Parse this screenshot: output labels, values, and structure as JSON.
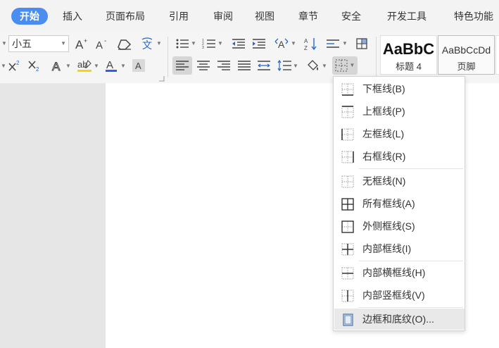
{
  "menubar": {
    "tabs": [
      {
        "label": "开始",
        "active": true
      },
      {
        "label": "插入"
      },
      {
        "label": "页面布局"
      },
      {
        "label": "引用"
      },
      {
        "label": "审阅"
      },
      {
        "label": "视图"
      },
      {
        "label": "章节"
      },
      {
        "label": "安全"
      },
      {
        "label": "开发工具"
      },
      {
        "label": "特色功能"
      }
    ]
  },
  "ribbon": {
    "font_size_value": "小五",
    "styles": [
      {
        "sample": "AaBbC",
        "label": "标题 4"
      },
      {
        "sample": "AaBbCcDd",
        "label": "页脚"
      }
    ],
    "icons": {
      "grow_font": "A⁺",
      "shrink_font": "A⁻",
      "pinyin": "文",
      "superscript": "X²",
      "subscript": "X₂",
      "highlight": "ab",
      "font_color": "A",
      "char_shading": "A"
    }
  },
  "border_menu": {
    "items": [
      {
        "label": "下框线(B)",
        "icon": "border-bottom-icon"
      },
      {
        "label": "上框线(P)",
        "icon": "border-top-icon"
      },
      {
        "label": "左框线(L)",
        "icon": "border-left-icon"
      },
      {
        "label": "右框线(R)",
        "icon": "border-right-icon"
      },
      {
        "label": "无框线(N)",
        "icon": "border-none-icon"
      },
      {
        "label": "所有框线(A)",
        "icon": "border-all-icon"
      },
      {
        "label": "外侧框线(S)",
        "icon": "border-outside-icon"
      },
      {
        "label": "内部框线(I)",
        "icon": "border-inside-icon"
      },
      {
        "label": "内部横框线(H)",
        "icon": "border-inside-horizontal-icon"
      },
      {
        "label": "内部竖框线(V)",
        "icon": "border-inside-vertical-icon"
      },
      {
        "label": "边框和底纹(O)...",
        "icon": "borders-and-shading-icon"
      }
    ]
  },
  "colors": {
    "accent": "#4a8df0",
    "highlight_yellow": "#f5d800",
    "font_color_blue": "#2f5fe0"
  }
}
